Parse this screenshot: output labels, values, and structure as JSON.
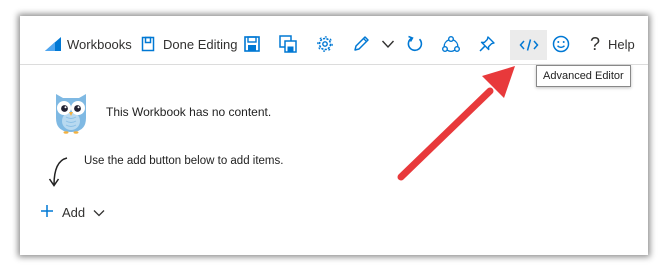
{
  "toolbar": {
    "workbooks_label": "Workbooks",
    "done_editing_label": "Done Editing",
    "help_label": "Help"
  },
  "tooltip": {
    "text": "Advanced Editor"
  },
  "content": {
    "empty_message": "This Workbook has no content.",
    "hint": "Use the add button below to add items.",
    "add_label": "Add"
  },
  "icons": {
    "workbooks": "workbooks-icon",
    "done_editing": "done-editing-icon",
    "save": "save-icon",
    "save_as": "save-as-icon",
    "settings": "gear-icon",
    "edit": "pencil-icon",
    "chevron": "chevron-down-icon",
    "refresh": "refresh-icon",
    "share": "share-icon",
    "pin": "pin-icon",
    "advanced_editor": "code-icon",
    "feedback": "smiley-icon",
    "help": "question-mark-icon",
    "add": "plus-icon"
  },
  "colors": {
    "accent": "#0078d4",
    "annotation_arrow": "#e8393b"
  }
}
